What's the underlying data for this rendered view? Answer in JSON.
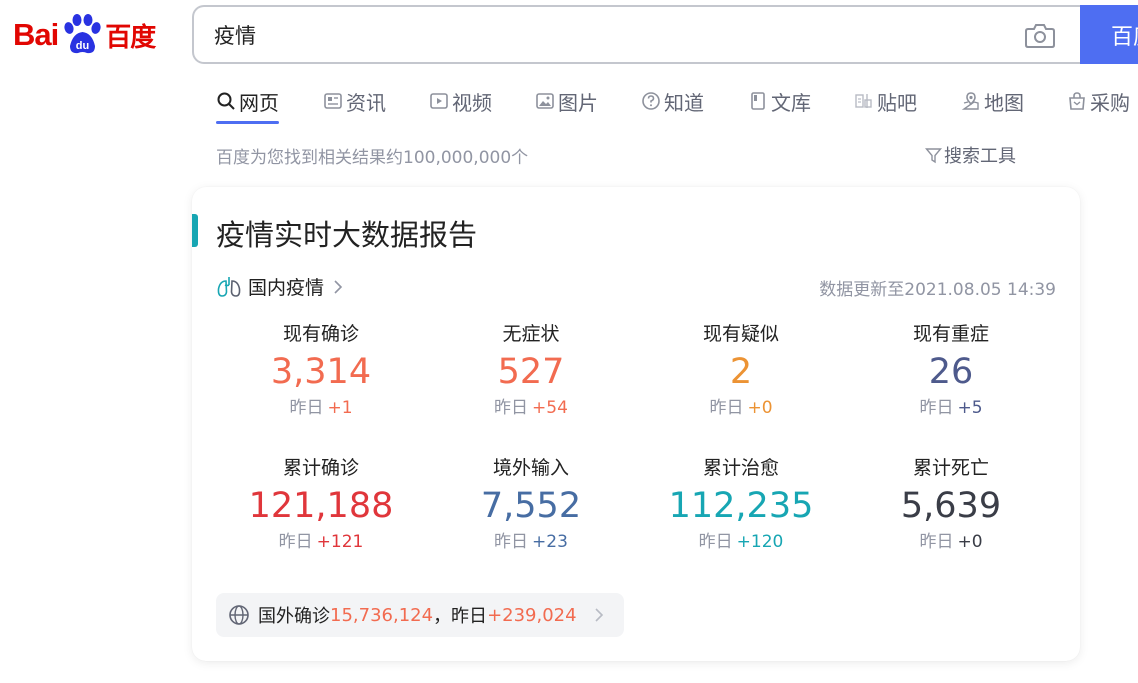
{
  "logo": {
    "latin": "Bai",
    "paw_text": "du",
    "chinese": "百度"
  },
  "search": {
    "query": "疫情",
    "button_label": "百度一下"
  },
  "tabs": [
    {
      "label": "网页",
      "icon": "search-icon",
      "active": true
    },
    {
      "label": "资讯",
      "icon": "news-icon"
    },
    {
      "label": "视频",
      "icon": "video-icon"
    },
    {
      "label": "图片",
      "icon": "image-icon"
    },
    {
      "label": "知道",
      "icon": "question-icon"
    },
    {
      "label": "文库",
      "icon": "document-icon"
    },
    {
      "label": "贴吧",
      "icon": "tieba-icon"
    },
    {
      "label": "地图",
      "icon": "map-icon"
    },
    {
      "label": "采购",
      "icon": "shopping-icon"
    }
  ],
  "results": {
    "count_text": "百度为您找到相关结果约100,000,000个",
    "tools_label": "搜索工具"
  },
  "card": {
    "title": "疫情实时大数据报告",
    "region_label": "国内疫情",
    "update_time": "数据更新至2021.08.05 14:39",
    "yesterday_prefix": "昨日",
    "stats": [
      {
        "label": "现有确诊",
        "value": "3,314",
        "delta": "+1",
        "color": "#f26b50"
      },
      {
        "label": "无症状",
        "value": "527",
        "delta": "+54",
        "color": "#f26b50"
      },
      {
        "label": "现有疑似",
        "value": "2",
        "delta": "+0",
        "color": "#ec9334"
      },
      {
        "label": "现有重症",
        "value": "26",
        "delta": "+5",
        "color": "#4e5a8c"
      },
      {
        "label": "累计确诊",
        "value": "121,188",
        "delta": "+121",
        "color": "#e0363b"
      },
      {
        "label": "境外输入",
        "value": "7,552",
        "delta": "+23",
        "color": "#476da3"
      },
      {
        "label": "累计治愈",
        "value": "112,235",
        "delta": "+120",
        "color": "#17a6b3"
      },
      {
        "label": "累计死亡",
        "value": "5,639",
        "delta": "+0",
        "color": "#3a3d47"
      }
    ],
    "foreign": {
      "label": "国外确诊",
      "value": "15,736,124",
      "separator": "，昨日",
      "delta": "+239,024",
      "color": "#f26b50"
    }
  }
}
